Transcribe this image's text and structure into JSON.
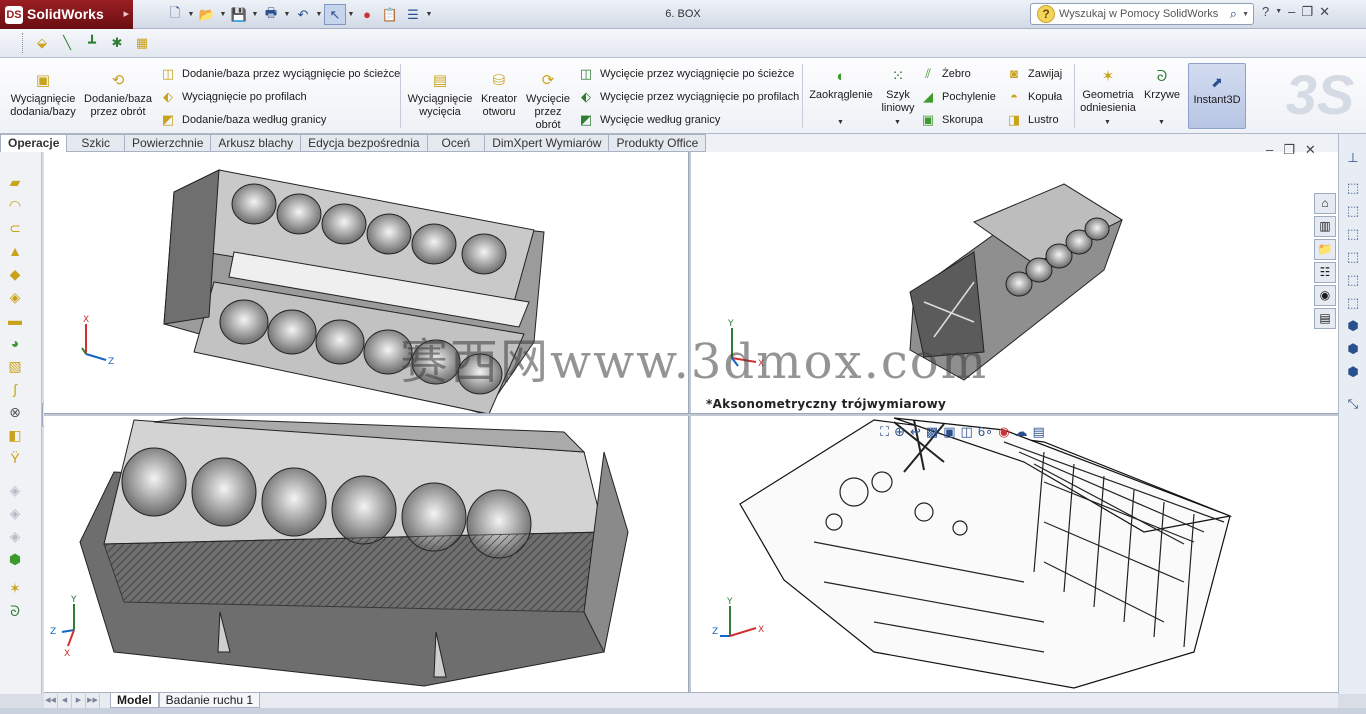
{
  "app": {
    "name": "SolidWorks",
    "logo_mark": "DS",
    "document_title": "6. BOX"
  },
  "search": {
    "placeholder": "Wyszukaj w Pomocy SolidWorks",
    "help_symbol": "?"
  },
  "ribbon": {
    "extrude_boss": "Wyciągnięcie dodania/bazy",
    "revolve_boss": "Dodanie/baza przez obrót",
    "swept_boss": "Dodanie/baza przez wyciągnięcie po ścieżce",
    "loft_boss": "Wyciągnięcie po profilach",
    "boundary_boss": "Dodanie/baza według granicy",
    "extrude_cut": "Wyciągnięcie wycięcia",
    "hole_wizard": "Kreator otworu",
    "revolve_cut": "Wycięcie przez obrót",
    "swept_cut": "Wycięcie przez wyciągnięcie po ścieżce",
    "loft_cut": "Wycięcie przez wyciągnięcie po profilach",
    "boundary_cut": "Wycięcie według granicy",
    "fillet": "Zaokrąglenie",
    "linear_pattern": "Szyk liniowy",
    "rib": "Żebro",
    "draft": "Pochylenie",
    "shell": "Skorupa",
    "wrap": "Zawijaj",
    "dome": "Kopuła",
    "mirror": "Lustro",
    "ref_geometry": "Geometria odniesienia",
    "curves": "Krzywe",
    "instant3d": "Instant3D"
  },
  "tabs": [
    "Operacje",
    "Szkic",
    "Powierzchnie",
    "Arkusz blachy",
    "Edycja bezpośrednia",
    "Oceń",
    "DimXpert Wymiarów",
    "Produkty Office"
  ],
  "viewport": {
    "view_label": "*Aksonometryczny trójwymiarowy",
    "watermark": "赛西网www.3dmox.com",
    "triad_x": "X",
    "triad_y": "Y",
    "triad_z": "Z"
  },
  "bottom_tabs": [
    "Model",
    "Badanie ruchu 1"
  ],
  "colors": {
    "logo_red": "#9a1f24",
    "accent_blue": "#2a4f8d",
    "part_gray": "#8c8c8c"
  }
}
